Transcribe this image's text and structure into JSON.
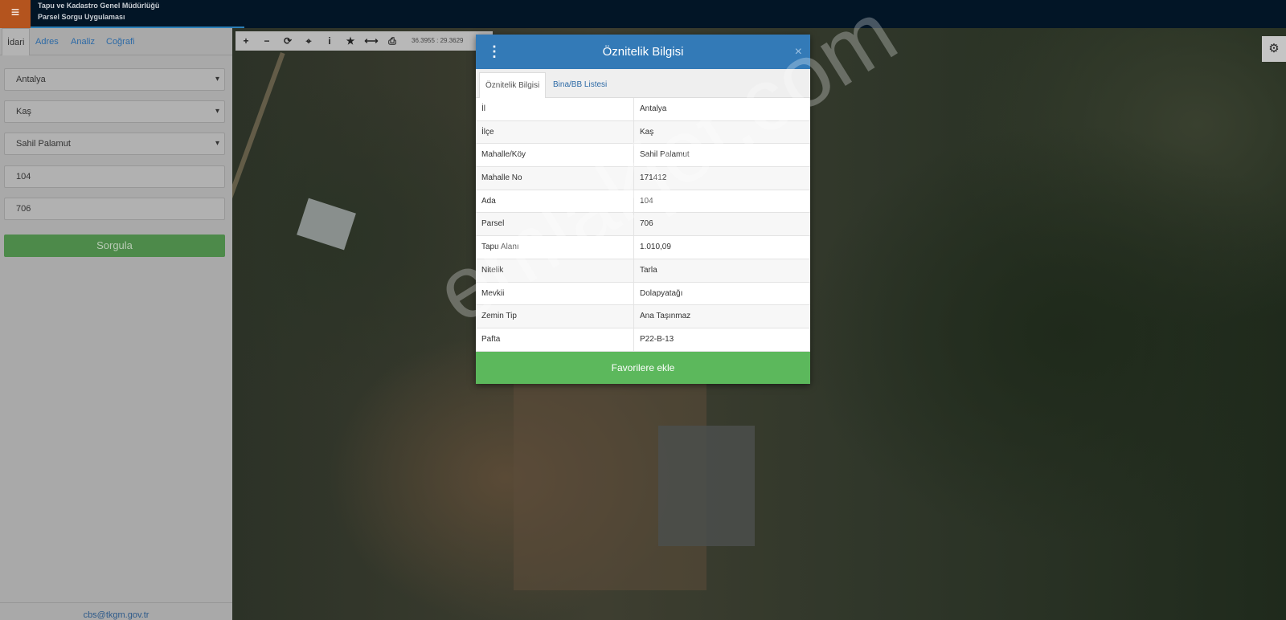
{
  "app": {
    "menu_icon": "hamburger-icon",
    "title_line1": "Tapu ve Kadastro Genel Müdürlüğü",
    "title_line2": "Parsel Sorgu Uygulaması"
  },
  "sidebar": {
    "tabs": [
      "İdari",
      "Adres",
      "Analiz",
      "Coğrafi"
    ],
    "active_tab": "İdari",
    "fields": {
      "il": "Antalya",
      "ilce": "Kaş",
      "mahalle": "Sahil Palamut",
      "ada": "104",
      "parsel": "706"
    },
    "query_label": "Sorgula",
    "footer": "cbs@tkgm.gov.tr"
  },
  "toolbar": {
    "tools": [
      "+",
      "−",
      "⟳",
      "⌖",
      "i",
      "★",
      "⟷",
      "⎙"
    ],
    "coords": "36.3955 : 29.3629"
  },
  "modal": {
    "title": "Öznitelik Bilgisi",
    "close": "×",
    "tabs": [
      "Öznitelik Bilgisi",
      "Bina/BB Listesi"
    ],
    "rows": [
      {
        "key": "İl",
        "value": "Antalya"
      },
      {
        "key": "İlçe",
        "value": "Kaş"
      },
      {
        "key": "Mahalle/Köy",
        "value": "Sahil Palamut"
      },
      {
        "key": "Mahalle No",
        "value": "171412"
      },
      {
        "key": "Ada",
        "value": "104"
      },
      {
        "key": "Parsel",
        "value": "706"
      },
      {
        "key": "Tapu Alanı",
        "value": "1.010,09"
      },
      {
        "key": "Nitelik",
        "value": "Tarla"
      },
      {
        "key": "Mevkii",
        "value": "Dolapyatağı"
      },
      {
        "key": "Zemin Tip",
        "value": "Ana Taşınmaz"
      },
      {
        "key": "Pafta",
        "value": "P22-B-13"
      }
    ],
    "favorite_label": "Favorilere ekle"
  },
  "watermark": "emlakjet.com",
  "colors": {
    "header_bg": "#021526",
    "menu_btn": "#b4541e",
    "modal_header": "#337ab7",
    "favorite_btn": "#5cb85c",
    "query_btn": "#4d8a4a"
  }
}
